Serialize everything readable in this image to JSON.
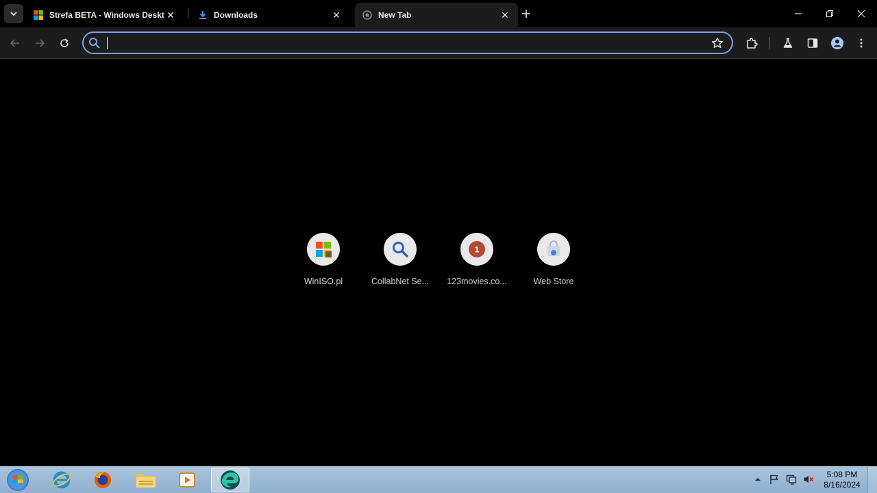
{
  "tabs": [
    {
      "title": "Strefa BETA - Windows Desktop",
      "icon": "windows-logo-icon"
    },
    {
      "title": "Downloads",
      "icon": "download-icon"
    },
    {
      "title": "New Tab",
      "icon": "chrome-icon",
      "active": true
    }
  ],
  "omnibox": {
    "value": "",
    "placeholder": ""
  },
  "shortcuts": [
    {
      "label": "WinISO.pl",
      "icon": "winiso-icon"
    },
    {
      "label": "CollabNet Se...",
      "icon": "magnifier-icon"
    },
    {
      "label": "123movies.co...",
      "icon": "badge-icon",
      "badge": "1"
    },
    {
      "label": "Web Store",
      "icon": "web-store-icon"
    }
  ],
  "taskbar": {
    "apps": [
      "internet-explorer-icon",
      "firefox-icon",
      "file-explorer-icon",
      "media-player-icon",
      "edge-beta-icon"
    ],
    "clock": {
      "time": "5:08 PM",
      "date": "8/16/2024"
    }
  },
  "colors": {
    "accent": "#7fa0e6",
    "toolbar": "#1c1c1c",
    "background": "#000000"
  }
}
